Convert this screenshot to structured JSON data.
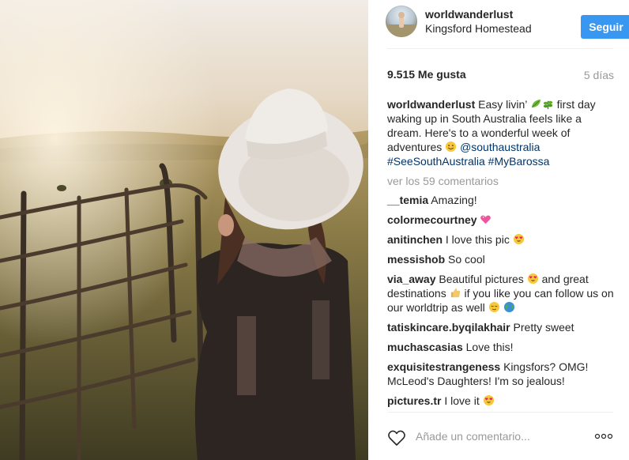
{
  "post": {
    "username": "worldwanderlust",
    "location": "Kingsford Homestead",
    "follow_label": "Seguir",
    "likes": "9.515 Me gusta",
    "time_ago": "5 días"
  },
  "caption": {
    "username": "worldwanderlust",
    "text_before": "Easy livin’",
    "text_mid": "first day waking up in South Australia feels like a dream. Here's to a wonderful week of adventures",
    "mention": "@southaustralia",
    "hashtag1": "#SeeSouthAustralia",
    "hashtag2": "#MyBarossa"
  },
  "view_all": "ver los 59 comentarios",
  "comments": [
    {
      "user": "__temia",
      "text": "Amazing!"
    },
    {
      "user": "colormecourtney",
      "text": ""
    },
    {
      "user": "anitinchen",
      "text": "I love this pic"
    },
    {
      "user": "messishob",
      "text": "So cool"
    },
    {
      "user": "via_away",
      "text_a": "Beautiful pictures",
      "text_b": "and great destinations",
      "text_c": "if you like you can follow us on our worldtrip as well"
    },
    {
      "user": "tatiskincare.byqilakhair",
      "text": "Pretty sweet"
    },
    {
      "user": "muchascasias",
      "text": "Love this!"
    },
    {
      "user": "exquisitestrangeness",
      "text": "Kingsfors? OMG! McLeod's Daughters! I'm so jealous!"
    },
    {
      "user": "pictures.tr",
      "text": "I love it"
    }
  ],
  "add_comment_placeholder": "Añade un comentario...",
  "icons": {
    "leaf": "leaf-emoji-icon",
    "herb": "herb-emoji-icon",
    "smile": "smile-emoji-icon",
    "heart_pink": "sparkling-heart-emoji-icon",
    "heart_eyes": "heart-eyes-emoji-icon",
    "thumbs_up": "thumbs-up-emoji-icon",
    "relieved": "relieved-emoji-icon",
    "globe": "globe-emoji-icon",
    "like": "heart-outline-icon",
    "options": "more-options-icon"
  },
  "colors": {
    "follow_button": "#3897f0",
    "link": "#003569",
    "muted": "#999999"
  }
}
